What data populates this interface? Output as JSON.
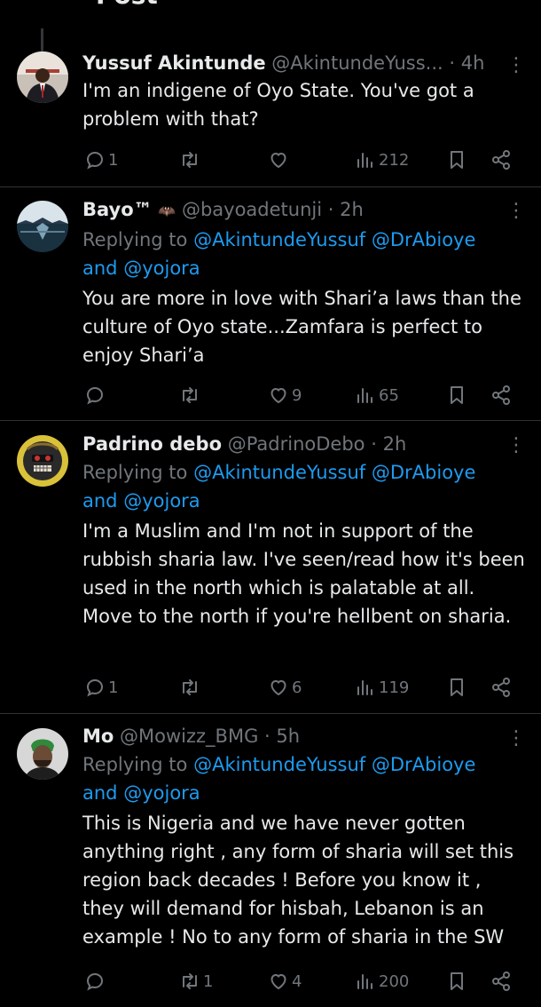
{
  "header": {
    "back_icon": "arrow-left-icon",
    "title": "Post"
  },
  "tweets": [
    {
      "name": "Yussuf Akintunde",
      "handle": "@AkintundeYuss...",
      "dot": "·",
      "time": "4h",
      "text": "I'm an indigene of Oyo State. You've got a problem with that?",
      "stats": {
        "replies": "1",
        "reposts": "",
        "likes": "",
        "views": "212"
      }
    },
    {
      "name": "Bayo™",
      "badge_icon": "bat-emoji-icon",
      "handle": "@bayoadetunji",
      "dot": "·",
      "time": "2h",
      "replying_prefix": "Replying to",
      "mention1": "@AkintundeYussuf",
      "mention2": "@DrAbioye",
      "and": "and",
      "mention3": "@yojora",
      "text": "You are more in love with Shari’a laws than the culture of Oyo state...Zamfara is perfect to enjoy Shari’a",
      "stats": {
        "replies": "",
        "reposts": "",
        "likes": "9",
        "views": "65"
      }
    },
    {
      "name": "Padrino debo",
      "handle": "@PadrinoDebo",
      "dot": "·",
      "time": "2h",
      "replying_prefix": "Replying to",
      "mention1": "@AkintundeYussuf",
      "mention2": "@DrAbioye",
      "and": "and",
      "mention3": "@yojora",
      "text": "I'm a Muslim and I'm not in support of the rubbish sharia law. I've seen/read how it's been used in the north which is palatable at all. Move to the north if you're hellbent on sharia.",
      "stats": {
        "replies": "1",
        "reposts": "",
        "likes": "6",
        "views": "119"
      }
    },
    {
      "name": "Mo",
      "handle": "@Mowizz_BMG",
      "dot": "·",
      "time": "5h",
      "replying_prefix": "Replying to",
      "mention1": "@AkintundeYussuf",
      "mention2": "@DrAbioye",
      "and": "and",
      "mention3": "@yojora",
      "text": "This is Nigeria and we have  never gotten anything right , any form of sharia will set this region back decades ! Before you know it , they will demand for hisbah, Lebanon is an example ! No to any form of sharia in the SW",
      "stats": {
        "replies": "",
        "reposts": "1",
        "likes": "4",
        "views": "200"
      }
    }
  ],
  "icons": {
    "reply": "reply-icon",
    "repost": "repost-icon",
    "like": "heart-icon",
    "views": "views-icon",
    "bookmark": "bookmark-icon",
    "share": "share-icon",
    "more": "more-options-icon"
  },
  "colors": {
    "background": "#000000",
    "text": "#e7e9ea",
    "muted": "#71767b",
    "link": "#1d9bf0",
    "divider": "#2f3336"
  }
}
